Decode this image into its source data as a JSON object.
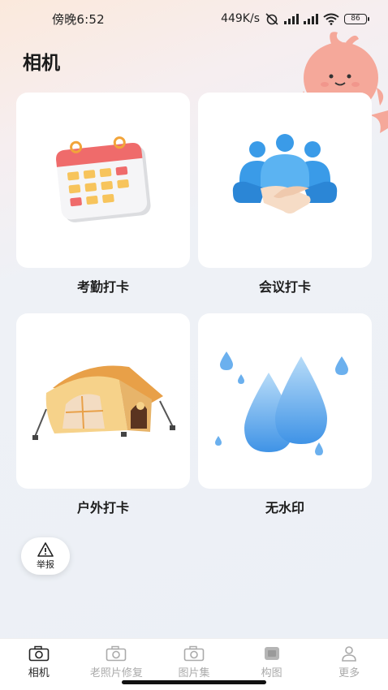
{
  "status_bar": {
    "time": "傍晚6:52",
    "net_speed": "449K/s",
    "battery": "86"
  },
  "page": {
    "title": "相机"
  },
  "cards": [
    {
      "label": "考勤打卡",
      "icon": "calendar-icon"
    },
    {
      "label": "会议打卡",
      "icon": "handshake-icon"
    },
    {
      "label": "户外打卡",
      "icon": "tent-icon"
    },
    {
      "label": "无水印",
      "icon": "water-drops-icon"
    }
  ],
  "report": {
    "label": "举报",
    "icon": "warning-icon"
  },
  "tabs": [
    {
      "label": "相机",
      "icon": "camera-icon",
      "active": true
    },
    {
      "label": "老照片修复",
      "icon": "camera-icon",
      "active": false
    },
    {
      "label": "图片集",
      "icon": "camera-icon",
      "active": false
    },
    {
      "label": "构图",
      "icon": "frame-icon",
      "active": false
    },
    {
      "label": "更多",
      "icon": "person-icon",
      "active": false
    }
  ],
  "colors": {
    "active_tab": "#222222",
    "inactive_tab": "#aaaaaa",
    "card_bg": "#ffffff"
  }
}
